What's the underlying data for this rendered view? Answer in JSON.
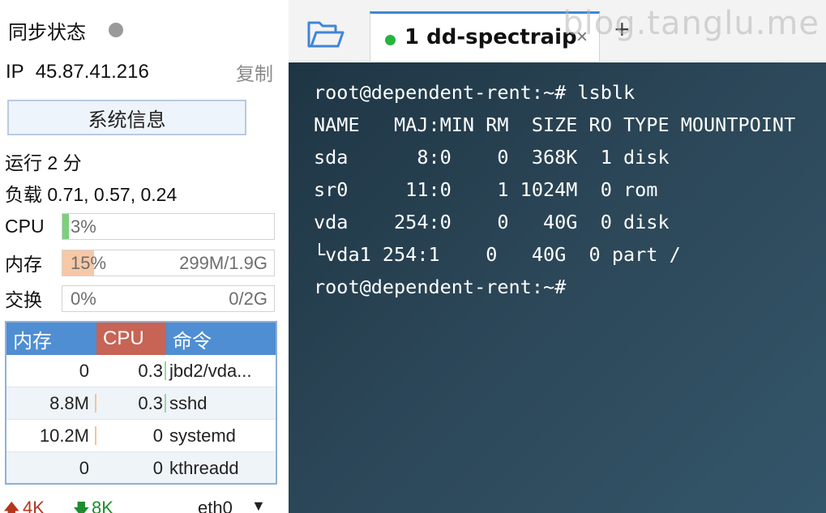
{
  "sidebar": {
    "sync_label": "同步状态",
    "sync_status_color": "#9a9a9a",
    "ip_label": "IP",
    "ip_value": "45.87.41.216",
    "copy_label": "复制",
    "sysinfo_button": "系统信息",
    "uptime": "运行 2 分",
    "load": "负载 0.71, 0.57, 0.24",
    "metrics": {
      "cpu": {
        "label": "CPU",
        "percent_text": "3%",
        "fraction": 0.03,
        "value": "",
        "fill_color": "#7ccf7c"
      },
      "mem": {
        "label": "内存",
        "percent_text": "15%",
        "fraction": 0.15,
        "value": "299M/1.9G",
        "fill_color": "#f7c8a6"
      },
      "swap": {
        "label": "交换",
        "percent_text": "0%",
        "fraction": 0.0,
        "value": "0/2G",
        "fill_color": "#cfe3f5"
      }
    },
    "process_table": {
      "headers": {
        "mem": "内存",
        "cpu": "CPU",
        "cmd": "命令"
      },
      "header_colors": {
        "mem": "#4f8ed2",
        "cpu": "#c76455",
        "cmd": "#4f8ed2"
      },
      "rows": [
        {
          "mem": "0",
          "cpu": "0.3",
          "cmd": "jbd2/vda..."
        },
        {
          "mem": "8.8M",
          "cpu": "0.3",
          "cmd": "sshd"
        },
        {
          "mem": "10.2M",
          "cpu": "0",
          "cmd": "systemd"
        },
        {
          "mem": "0",
          "cpu": "0",
          "cmd": "kthreadd"
        }
      ]
    },
    "network": {
      "up_icon": "arrow-up-icon",
      "up_value": "4K",
      "down_icon": "arrow-down-icon",
      "down_value": "8K",
      "interface": "eth0"
    }
  },
  "tabs": {
    "folder_icon": "folder-open-icon",
    "active_tab": {
      "title": "1  dd-spectraip",
      "status_color": "#27b33c"
    },
    "close_symbol": "×",
    "new_tab_symbol": "+"
  },
  "watermark": "blog.tanglu.me",
  "terminal": {
    "lines": [
      "root@dependent-rent:~# lsblk",
      "NAME   MAJ:MIN RM  SIZE RO TYPE MOUNTPOINT",
      "sda      8:0    0  368K  1 disk",
      "sr0     11:0    1 1024M  0 rom",
      "vda    254:0    0   40G  0 disk",
      "└vda1 254:1    0   40G  0 part /",
      "root@dependent-rent:~#"
    ]
  }
}
